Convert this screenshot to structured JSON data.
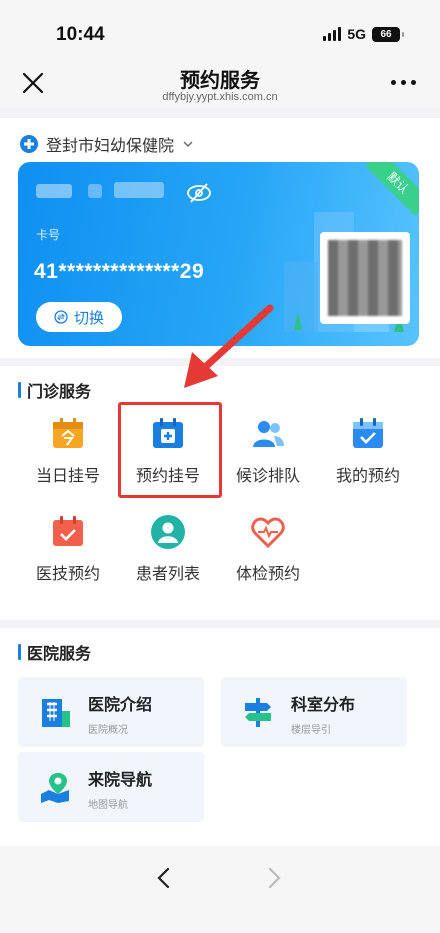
{
  "status": {
    "time": "10:44",
    "network": "5G",
    "battery": "66"
  },
  "nav": {
    "title": "预约服务",
    "url": "dffybjy.yypt.xhis.com.cn"
  },
  "hospital": {
    "name": "登封市妇幼保健院"
  },
  "card": {
    "number_label": "卡号",
    "number": "41**************29",
    "switch_label": "切换",
    "default_badge": "默认"
  },
  "outpatient": {
    "title": "门诊服务",
    "items": [
      {
        "label": "当日挂号",
        "icon": "today-register-icon"
      },
      {
        "label": "预约挂号",
        "icon": "appointment-register-icon"
      },
      {
        "label": "候诊排队",
        "icon": "queue-icon"
      },
      {
        "label": "我的预约",
        "icon": "my-appointment-icon"
      },
      {
        "label": "医技预约",
        "icon": "medical-tech-icon"
      },
      {
        "label": "患者列表",
        "icon": "patient-list-icon"
      },
      {
        "label": "体检预约",
        "icon": "checkup-icon"
      }
    ]
  },
  "hospital_services": {
    "title": "医院服务",
    "tiles": [
      {
        "title": "医院介绍",
        "subtitle": "医院概况",
        "icon": "hospital-building-icon"
      },
      {
        "title": "科室分布",
        "subtitle": "楼层导引",
        "icon": "signpost-icon"
      },
      {
        "title": "来院导航",
        "subtitle": "地图导航",
        "icon": "map-pin-icon"
      }
    ]
  },
  "colors": {
    "accent": "#1a7fe0",
    "highlight": "#e53935",
    "orange": "#f5a623",
    "red": "#f0604d"
  }
}
